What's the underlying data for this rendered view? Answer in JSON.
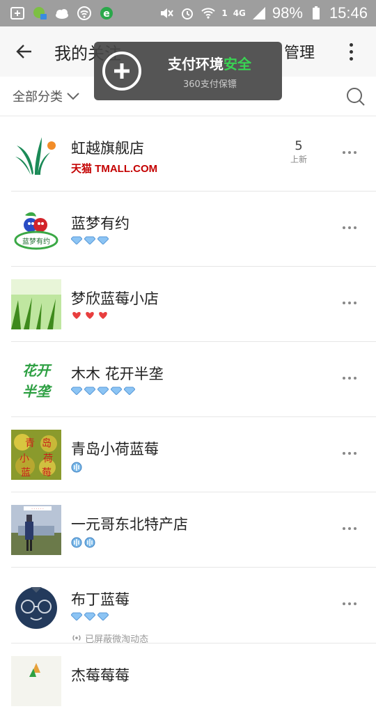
{
  "status_bar": {
    "network": "4G",
    "sim": "1",
    "battery": "98%",
    "time": "15:46"
  },
  "header": {
    "title": "我的关注",
    "manage_label": "管理"
  },
  "toast": {
    "title_main": "支付环境",
    "title_accent": "安全",
    "subtitle": "360支付保镖"
  },
  "filter": {
    "label": "全部分类"
  },
  "stores": [
    {
      "name": "虹越旗舰店",
      "badge": "tmall",
      "badge_text": "天猫 TMALL.COM",
      "new_count": "5",
      "new_label": "上新",
      "logo": "hongyue-logo"
    },
    {
      "name": "蓝梦有约",
      "badge": "diamond",
      "count": 3,
      "logo": "lanmeng-logo"
    },
    {
      "name": "梦欣蓝莓小店",
      "badge": "heart",
      "count": 3,
      "logo": "grass-logo"
    },
    {
      "name": "木木 花开半垄",
      "badge": "diamond",
      "count": 5,
      "logo": "huakai-logo"
    },
    {
      "name": "青岛小荷蓝莓",
      "badge": "crown",
      "count": 1,
      "logo": "qingdao-logo"
    },
    {
      "name": "一元哥东北特产店",
      "badge": "crown",
      "count": 2,
      "logo": "yiyuange-logo"
    },
    {
      "name": "布丁蓝莓",
      "badge": "diamond",
      "count": 3,
      "blocked_text": "已屏蔽微淘动态",
      "logo": "buding-logo"
    },
    {
      "name": "杰莓莓莓",
      "badge": "none",
      "logo": "partial-logo"
    }
  ],
  "colors": {
    "tmall_red": "#c40000",
    "toast_green": "#39d353",
    "header_bg": "#f7f7f7"
  }
}
